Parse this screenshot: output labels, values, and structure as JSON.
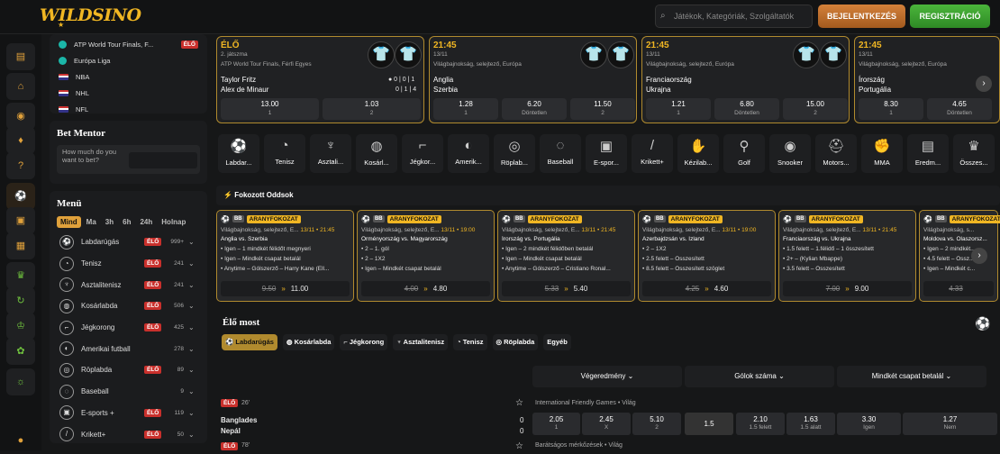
{
  "header": {
    "logo": "WILDSINO",
    "search_placeholder": "Játékok, Kategóriák, Szolgáltatók",
    "login": "BEJELENTKEZÉS",
    "register": "REGISZTRÁCIÓ"
  },
  "toplist": [
    {
      "label": "ATP World Tour Finals, F...",
      "live": "ÉLŐ"
    },
    {
      "label": "Európa Liga"
    },
    {
      "label": "NBA"
    },
    {
      "label": "NHL"
    },
    {
      "label": "NFL"
    }
  ],
  "bet_mentor": {
    "title": "Bet Mentor",
    "question": "How much do you want to bet?"
  },
  "menu": {
    "title": "Menü",
    "tabs": [
      "Mind",
      "Ma",
      "3h",
      "6h",
      "24h",
      "Holnap"
    ],
    "items": [
      {
        "label": "Labdarúgás",
        "live": "ÉLŐ",
        "count": "999+",
        "icon": "⚽"
      },
      {
        "label": "Tenisz",
        "live": "ÉLŐ",
        "count": "241",
        "icon": "◔"
      },
      {
        "label": "Asztalitenisz",
        "live": "ÉLŐ",
        "count": "241",
        "icon": "♆"
      },
      {
        "label": "Kosárlabda",
        "live": "ÉLŐ",
        "count": "506",
        "icon": "◍"
      },
      {
        "label": "Jégkorong",
        "live": "ÉLŐ",
        "count": "425",
        "icon": "⌐"
      },
      {
        "label": "Amerikai futball",
        "live": "",
        "count": "278",
        "icon": "◐"
      },
      {
        "label": "Röplabda",
        "live": "ÉLŐ",
        "count": "89",
        "icon": "◎"
      },
      {
        "label": "Baseball",
        "live": "",
        "count": "9",
        "icon": "◌"
      },
      {
        "label": "E-sports +",
        "live": "ÉLŐ",
        "count": "119",
        "icon": "▣"
      },
      {
        "label": "Krikett+",
        "live": "ÉLŐ",
        "count": "50",
        "icon": "/"
      }
    ]
  },
  "matches": [
    {
      "time": "ÉLŐ",
      "sub": "2. játszma",
      "comp": "ATP World Tour Finals, Férfi Egyes",
      "t1": "Taylor Fritz",
      "t2": "Alex de Minaur",
      "score1": "● 0 | 0 | 1",
      "score2": "0 | 1 | 4",
      "odds": [
        {
          "v": "13.00",
          "l": "1"
        },
        {
          "v": "1.03",
          "l": "2"
        }
      ]
    },
    {
      "time": "21:45",
      "sub": "13/11",
      "comp": "Világbajnokság, selejtező, Európa",
      "t1": "Anglia",
      "t2": "Szerbia",
      "odds": [
        {
          "v": "1.28",
          "l": "1"
        },
        {
          "v": "6.20",
          "l": "Döntetlen"
        },
        {
          "v": "11.50",
          "l": "2"
        }
      ]
    },
    {
      "time": "21:45",
      "sub": "13/11",
      "comp": "Világbajnokság, selejtező, Európa",
      "t1": "Franciaország",
      "t2": "Ukrajna",
      "odds": [
        {
          "v": "1.21",
          "l": "1"
        },
        {
          "v": "6.80",
          "l": "Döntetlen"
        },
        {
          "v": "15.00",
          "l": "2"
        }
      ]
    },
    {
      "time": "21:45",
      "sub": "13/11",
      "comp": "Világbajnokság, selejtező, Európa",
      "t1": "Írország",
      "t2": "Portugália",
      "odds": [
        {
          "v": "8.30",
          "l": "1"
        },
        {
          "v": "4.65",
          "l": "Döntetlen"
        }
      ]
    }
  ],
  "sports": [
    {
      "l": "Labdar...",
      "i": "⚽"
    },
    {
      "l": "Tenisz",
      "i": "◔"
    },
    {
      "l": "Asztali...",
      "i": "♆"
    },
    {
      "l": "Kosárl...",
      "i": "◍"
    },
    {
      "l": "Jégkor...",
      "i": "⌐"
    },
    {
      "l": "Amerik...",
      "i": "◐"
    },
    {
      "l": "Röplab...",
      "i": "◎"
    },
    {
      "l": "Baseball",
      "i": "◌"
    },
    {
      "l": "E-spor...",
      "i": "▣"
    },
    {
      "l": "Krikett+",
      "i": "/"
    },
    {
      "l": "Kézilab...",
      "i": "✋"
    },
    {
      "l": "Golf",
      "i": "⚲"
    },
    {
      "l": "Snooker",
      "i": "◉"
    },
    {
      "l": "Motors...",
      "i": "⛑"
    },
    {
      "l": "MMA",
      "i": "✊"
    },
    {
      "l": "Eredm...",
      "i": "▤"
    },
    {
      "l": "Összes...",
      "i": "♛"
    }
  ],
  "boost": {
    "title": "Fokozott Oddsok",
    "tag": "ARANYFOKOZAT",
    "bb": "BB",
    "cards": [
      {
        "comp": "Világbajnokság, selejtező, E...",
        "date": "13/11 • 21:45",
        "match": "Anglia vs. Szerbia",
        "lines": [
          "Igen – 1 mindkét félidőt megnyeri",
          "Igen – Mindkét csapat betalál",
          "Anytime – Gólszerző – Harry Kane (Ell..."
        ],
        "old": "9.50",
        "new": "11.00"
      },
      {
        "comp": "Világbajnokság, selejtező, E...",
        "date": "13/11 • 19:00",
        "match": "Örményország vs. Magyarország",
        "lines": [
          "2 – 1. gól",
          "2 – 1X2",
          "Igen – Mindkét csapat betalál"
        ],
        "old": "4.00",
        "new": "4.80"
      },
      {
        "comp": "Világbajnokság, selejtező, E...",
        "date": "13/11 • 21:45",
        "match": "Írország vs. Portugália",
        "lines": [
          "Igen – 2 mindkét félidőben betalál",
          "Igen – Mindkét csapat betalál",
          "Anytime – Gólszerző – Cristiano Ronal..."
        ],
        "old": "5.33",
        "new": "5.40"
      },
      {
        "comp": "Világbajnokság, selejtező, E...",
        "date": "13/11 • 19:00",
        "match": "Azerbajdzsán vs. Izland",
        "lines": [
          "2 – 1X2",
          "2.5 felett – Összesített",
          "8.5 felett – Összesített szöglet"
        ],
        "old": "4.25",
        "new": "4.60"
      },
      {
        "comp": "Világbajnokság, selejtező, E...",
        "date": "13/11 • 21:45",
        "match": "Franciaország vs. Ukrajna",
        "lines": [
          "1.5 felett – 1.félidő – 1 összesített",
          "2+ – (Kylian Mbappe)",
          "3.5 felett – Összesített"
        ],
        "old": "7.00",
        "new": "9.00"
      },
      {
        "comp": "Világbajnokság, s...",
        "date": "",
        "match": "Moldova vs. Olaszorsz...",
        "lines": [
          "Igen – 2 mindkét...",
          "4.5 felett – Össz...",
          "Igen – Mindkét c..."
        ],
        "old": "4.33",
        "new": ""
      }
    ]
  },
  "live": {
    "title": "Élő most",
    "tabs": [
      {
        "l": "Labdarúgás",
        "i": "⚽"
      },
      {
        "l": "Kosárlabda",
        "i": "◍"
      },
      {
        "l": "Jégkorong",
        "i": "⌐"
      },
      {
        "l": "Asztalitenisz",
        "i": "♆"
      },
      {
        "l": "Tenisz",
        "i": "◔"
      },
      {
        "l": "Röplabda",
        "i": "◎"
      },
      {
        "l": "Egyéb",
        "i": ""
      }
    ],
    "markets": [
      "Végeredmény",
      "Gólok száma",
      "Mindkét csapat betalál"
    ],
    "events": [
      {
        "live": "ÉLŐ",
        "min": "26'",
        "comp": "International Friendly Games • Világ",
        "t1": "Banglades",
        "t2": "Nepál",
        "s1": "0",
        "s2": "0",
        "odds": [
          {
            "v": "2.05",
            "l": "1"
          },
          {
            "v": "2.45",
            "l": "X"
          },
          {
            "v": "5.10",
            "l": "2"
          },
          {
            "v": "1.5",
            "l": ""
          },
          {
            "v": "2.10",
            "l": "1.5 felett"
          },
          {
            "v": "1.63",
            "l": "1.5 alatt"
          },
          {
            "v": "3.30",
            "l": "Igen"
          },
          {
            "v": "1.27",
            "l": "Nem"
          }
        ]
      },
      {
        "live": "ÉLŐ",
        "min": "78'",
        "comp": "Barátságos mérkőzések • Világ"
      }
    ]
  }
}
